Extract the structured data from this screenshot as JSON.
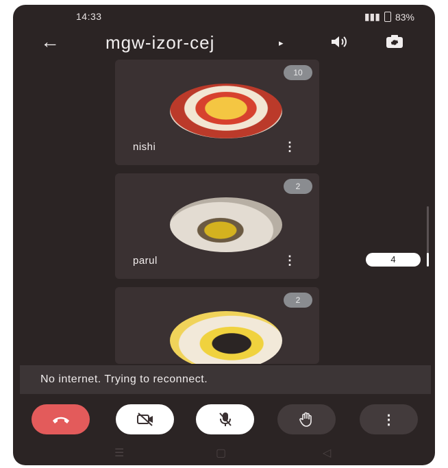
{
  "status_bar": {
    "time": "14:33",
    "battery_text": "83%"
  },
  "header": {
    "back_icon": "arrow-left-icon",
    "meeting_code": "mgw-izor-cej",
    "caret": "▸"
  },
  "participants": [
    {
      "name": "nishi",
      "badge": "10"
    },
    {
      "name": "parul",
      "badge": "2"
    },
    {
      "name": "",
      "badge": "2"
    }
  ],
  "scroll": {
    "count": "4"
  },
  "toast": {
    "message": "No internet. Trying to reconnect."
  },
  "controls": [
    {
      "icon": "end-call-icon"
    },
    {
      "icon": "camera-off-icon"
    },
    {
      "icon": "mic-off-icon"
    },
    {
      "icon": "raise-hand-icon"
    },
    {
      "icon": "more-vert-icon"
    }
  ],
  "colors": {
    "background": "#2b2424",
    "tile": "#3a3132",
    "end_call": "#e35b5b",
    "toast": "#3c3536"
  }
}
